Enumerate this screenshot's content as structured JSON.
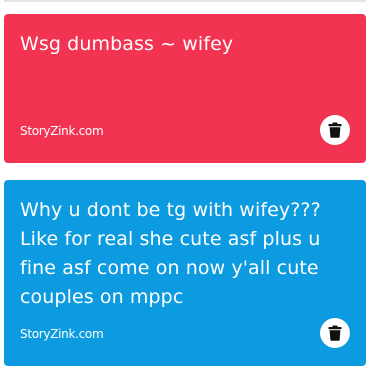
{
  "cards": [
    {
      "text": "Wsg dumbass ~ wifey",
      "source": "StoryZink.com",
      "color": "#f23352",
      "delete_icon": "trash-icon"
    },
    {
      "text": "Why u dont be tg with wifey??? Like for real she cute asf plus u fine asf come on now y'all cute couples on mppc",
      "source": "StoryZink.com",
      "color": "#0c9be0",
      "delete_icon": "trash-icon"
    }
  ]
}
